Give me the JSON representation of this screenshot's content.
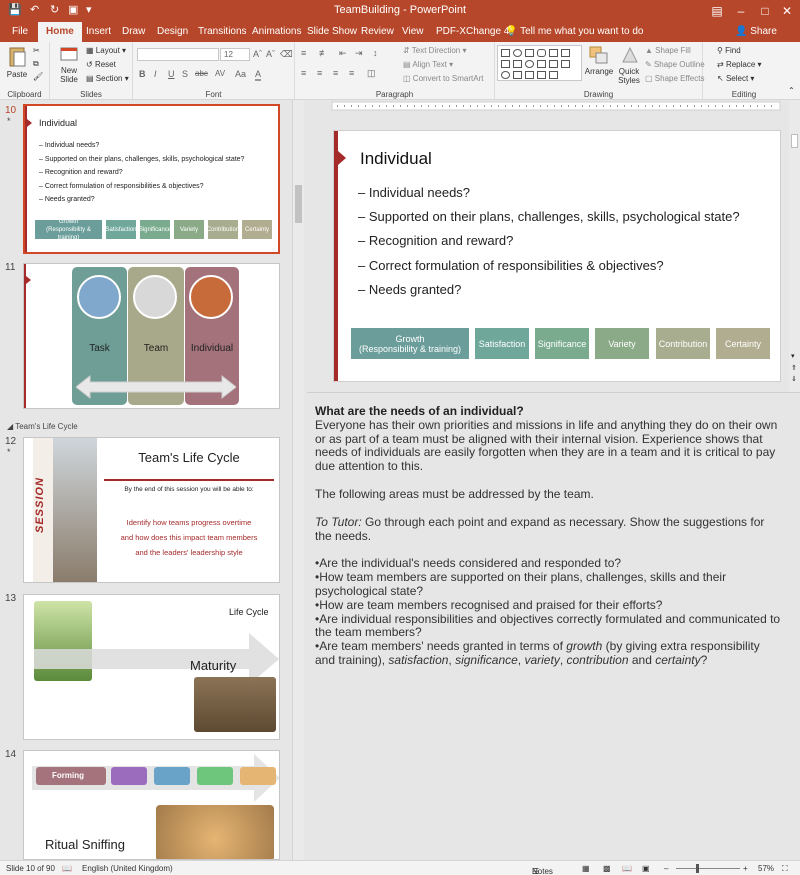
{
  "window": {
    "title": "TeamBuilding  -  PowerPoint",
    "share_label": "Share",
    "tell_me": "Tell me what you want to do"
  },
  "tabs": [
    "File",
    "Home",
    "Insert",
    "Draw",
    "Design",
    "Transitions",
    "Animations",
    "Slide Show",
    "Review",
    "View",
    "PDF-XChange 4"
  ],
  "active_tab": "Home",
  "ribbon": {
    "clipboard": {
      "label": "Clipboard",
      "paste": "Paste"
    },
    "slides": {
      "label": "Slides",
      "new_slide": "New Slide",
      "layout": "Layout",
      "reset": "Reset",
      "section": "Section"
    },
    "font": {
      "label": "Font",
      "font_name": "",
      "font_size": "12",
      "buttons": [
        "B",
        "I",
        "U",
        "S",
        "abc",
        "AV",
        "Aa",
        "A"
      ]
    },
    "paragraph": {
      "label": "Paragraph",
      "text_direction": "Text Direction",
      "align_text": "Align Text",
      "convert_smartart": "Convert to SmartArt"
    },
    "drawing": {
      "label": "Drawing",
      "arrange": "Arrange",
      "quick_styles": "Quick Styles",
      "shape_fill": "Shape Fill",
      "shape_outline": "Shape Outline",
      "shape_effects": "Shape Effects"
    },
    "editing": {
      "label": "Editing",
      "find": "Find",
      "replace": "Replace",
      "select": "Select"
    }
  },
  "slide_pane": {
    "slides": [
      {
        "number": "10",
        "starred": true,
        "selected": true,
        "title": "Individual",
        "bullets": [
          "– Individual needs?",
          "– Supported on their plans, challenges, skills, psychological state?",
          "– Recognition and reward?",
          "– Correct formulation of responsibilities & objectives?",
          "– Needs granted?"
        ],
        "tiles": [
          "Growth\n(Responsibility & training)",
          "Satisfaction",
          "Significance",
          "Variety",
          "Contribution",
          "Certainty"
        ]
      },
      {
        "number": "11",
        "starred": false,
        "columns": [
          "Task",
          "Team",
          "Individual"
        ]
      },
      {
        "number": "12",
        "starred": true,
        "title": "Team's Life Cycle",
        "session_label": "SESSION",
        "intro": "By the end of this session you will be able to:",
        "objectives": [
          "Identify how teams progress overtime",
          "and how does this impact team members",
          "and the leaders' leadership style"
        ]
      },
      {
        "number": "13",
        "starred": false,
        "title": "Life Cycle",
        "arrow_label": "Maturity"
      },
      {
        "number": "14",
        "starred": false,
        "stage_label": "Forming",
        "title": "Ritual Sniffing"
      }
    ],
    "section_label": "Team's Life Cycle"
  },
  "current_slide": {
    "title": "Individual",
    "bullets": [
      "– Individual needs?",
      "– Supported on their plans, challenges, skills, psychological state?",
      "– Recognition and reward?",
      "– Correct formulation of responsibilities & objectives?",
      "– Needs granted?"
    ],
    "tiles": [
      {
        "line1": "Growth",
        "line2": "(Responsibility & training)",
        "color": "#6b9e9a"
      },
      {
        "line1": "Satisfaction",
        "line2": "",
        "color": "#6fa79b"
      },
      {
        "line1": "Significance",
        "line2": "",
        "color": "#7aab8f"
      },
      {
        "line1": "Variety",
        "line2": "",
        "color": "#8aaa88"
      },
      {
        "line1": "Contribution",
        "line2": "",
        "color": "#a8ad8f"
      },
      {
        "line1": "Certainty",
        "line2": "",
        "color": "#b1ad90"
      }
    ]
  },
  "notes": {
    "title": "What are the needs of an individual?",
    "para1": "Everyone has their own priorities and missions in life and anything they do on their own or as part of a team must be aligned with their internal vision. Experience shows that needs of individuals are easily forgotten when they are in a team and it is critical to pay due attention to this.",
    "para2": "The following areas must be addressed by the team.",
    "tutor_label": "To Tutor:",
    "tutor_text": " Go through each point and expand as necessary. Show the suggestions for the needs.",
    "items": [
      "•Are the individual's needs considered and responded to?",
      "•How team members are supported on their plans, challenges, skills and their psychological state?",
      "•How are team members recognised and praised for their efforts?",
      "•Are individual responsibilities and objectives correctly formulated and communicated to the team members?"
    ],
    "last_item": {
      "a": "•Are team members' needs granted in terms of ",
      "growth": "growth",
      "b": " (by giving extra responsibility and training), ",
      "satisfaction": "satisfaction",
      "c": ", ",
      "significance": "significance",
      "d": ", ",
      "variety": "variety",
      "e": ", ",
      "contribution": "contribution",
      "f": " and ",
      "certainty": "certainty",
      "g": "?"
    }
  },
  "status": {
    "slide_info": "Slide 10 of 90",
    "language": "English (United Kingdom)",
    "notes_label": "Notes",
    "zoom": "57%"
  },
  "colors": {
    "brand": "#b7472a",
    "accent_bar": "#a52a2a",
    "selection": "#d24726"
  }
}
